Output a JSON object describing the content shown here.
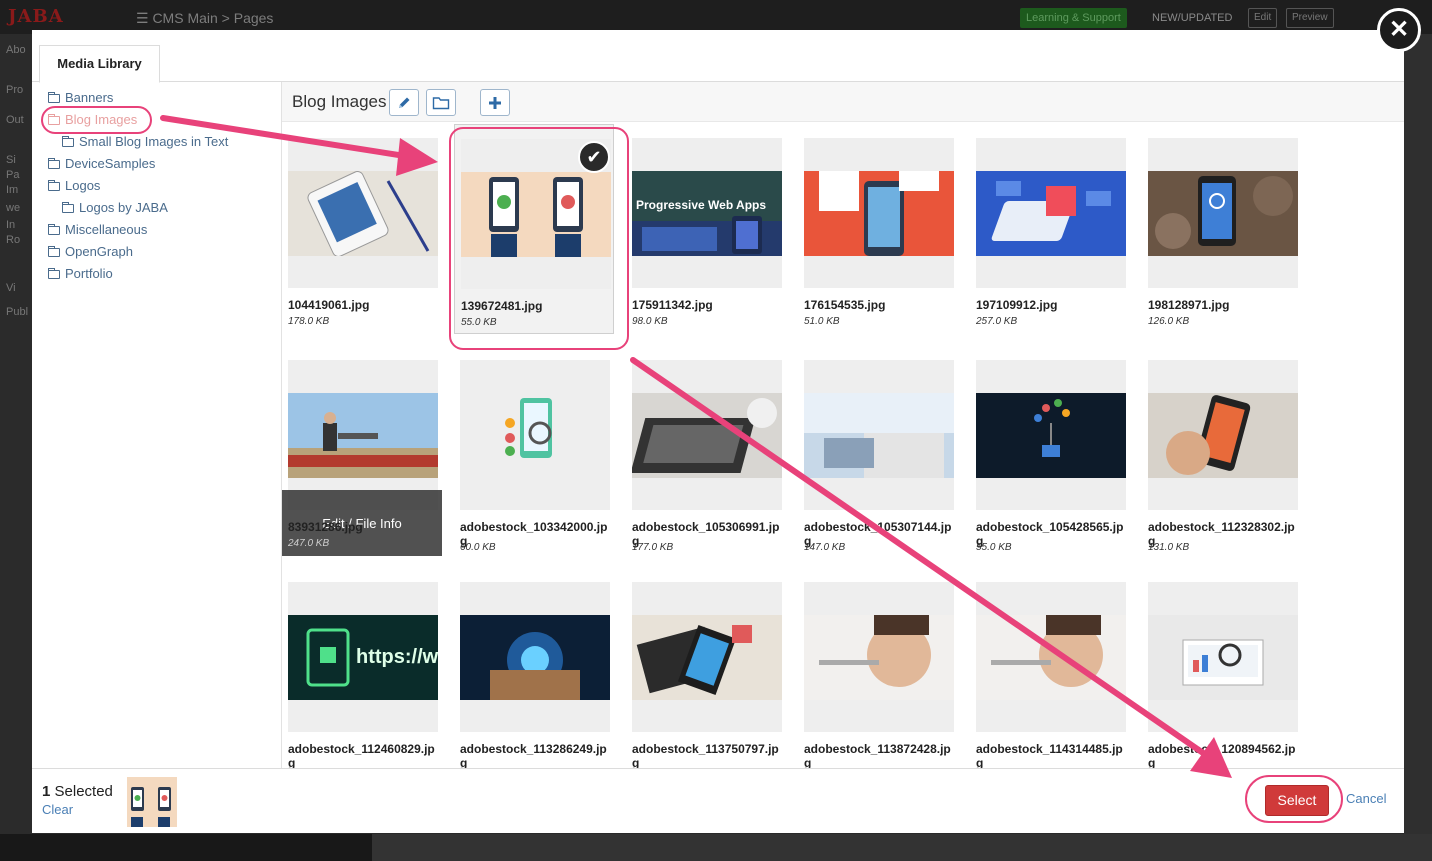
{
  "app": {
    "logo": "JABA",
    "breadcrumb": "☰ CMS Main  >  Pages",
    "learning": "Learning & Support",
    "new_updated": "NEW/UPDATED",
    "edit": "Edit",
    "preview": "Preview",
    "left_labels": [
      "Abo",
      "Pro",
      "Out",
      "Si",
      "Pa",
      "Im",
      "we",
      "In",
      "Ro",
      "Vi",
      "Publ"
    ]
  },
  "modal": {
    "tab": "Media Library",
    "close_icon": "close-icon"
  },
  "tree": [
    {
      "label": "Banners",
      "level": 0,
      "active": false
    },
    {
      "label": "Blog Images",
      "level": 0,
      "active": true
    },
    {
      "label": "Small Blog Images in Text",
      "level": 1,
      "active": false
    },
    {
      "label": "DeviceSamples",
      "level": 0,
      "active": false
    },
    {
      "label": "Logos",
      "level": 0,
      "active": false
    },
    {
      "label": "Logos by JABA",
      "level": 1,
      "active": false
    },
    {
      "label": "Miscellaneous",
      "level": 0,
      "active": false
    },
    {
      "label": "OpenGraph",
      "level": 0,
      "active": false
    },
    {
      "label": "Portfolio",
      "level": 0,
      "active": false
    }
  ],
  "toolbar": {
    "title": "Blog Images",
    "edit_icon": "pencil-icon",
    "folder_icon": "folder-icon",
    "add_icon": "plus-icon"
  },
  "files": [
    {
      "name": "104419061.jpg",
      "size": "178.0 KB",
      "selected": false,
      "hovered": false
    },
    {
      "name": "139672481.jpg",
      "size": "55.0 KB",
      "selected": true,
      "hovered": false
    },
    {
      "name": "175911342.jpg",
      "size": "98.0 KB",
      "selected": false,
      "hovered": false,
      "overlay_text": "Progressive Web Apps"
    },
    {
      "name": "176154535.jpg",
      "size": "51.0 KB",
      "selected": false,
      "hovered": false
    },
    {
      "name": "197109912.jpg",
      "size": "257.0 KB",
      "selected": false,
      "hovered": false
    },
    {
      "name": "198128971.jpg",
      "size": "126.0 KB",
      "selected": false,
      "hovered": false
    },
    {
      "name": "83931286.jpg",
      "size": "247.0 KB",
      "selected": false,
      "hovered": true
    },
    {
      "name": "adobestock_103342000.jpg",
      "size": "60.0 KB",
      "selected": false,
      "hovered": false
    },
    {
      "name": "adobestock_105306991.jpg",
      "size": "177.0 KB",
      "selected": false,
      "hovered": false
    },
    {
      "name": "adobestock_105307144.jpg",
      "size": "147.0 KB",
      "selected": false,
      "hovered": false
    },
    {
      "name": "adobestock_105428565.jpg",
      "size": "55.0 KB",
      "selected": false,
      "hovered": false
    },
    {
      "name": "adobestock_112328302.jpg",
      "size": "131.0 KB",
      "selected": false,
      "hovered": false
    },
    {
      "name": "adobestock_112460829.jpg",
      "size": "",
      "selected": false,
      "hovered": false
    },
    {
      "name": "adobestock_113286249.jpg",
      "size": "",
      "selected": false,
      "hovered": false
    },
    {
      "name": "adobestock_113750797.jpg",
      "size": "",
      "selected": false,
      "hovered": false
    },
    {
      "name": "adobestock_113872428.jpg",
      "size": "",
      "selected": false,
      "hovered": false
    },
    {
      "name": "adobestock_114314485.jpg",
      "size": "",
      "selected": false,
      "hovered": false
    },
    {
      "name": "adobestock_120894562.jpg",
      "size": "",
      "selected": false,
      "hovered": false
    }
  ],
  "hover_label": "Edit / File Info",
  "check_icon": "checkmark-icon",
  "footer": {
    "count": "1",
    "selected_label": " Selected",
    "clear": "Clear",
    "select": "Select",
    "cancel": "Cancel"
  },
  "colors": {
    "annotation": "#e8427a",
    "link": "#4a7fb5",
    "select_button": "#d03a3a",
    "tree_link": "#4a6b8c"
  }
}
